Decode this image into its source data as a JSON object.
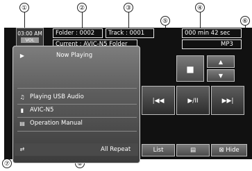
{
  "callouts": [
    "①",
    "②",
    "③",
    "④",
    "⑤",
    "⑥",
    "⑦",
    "⑧"
  ],
  "header": {
    "clock_time": "03:00",
    "clock_period": "AM",
    "clock_sub": "VOL",
    "folder": "Folder : 0002",
    "track": "Track : 0001",
    "time": "000 min  42 sec",
    "current_folder": "Current : AVIC-N5 Folder",
    "format": "MP3"
  },
  "list": {
    "items": [
      {
        "icon": "play-icon",
        "glyph": "▶",
        "label": "Now Playing"
      },
      {
        "icon": "music-file-icon",
        "glyph": "♫",
        "label": "Playing USB Audio"
      },
      {
        "icon": "folder-icon",
        "glyph": "▮",
        "label": "AVIC-N5"
      },
      {
        "icon": "document-icon",
        "glyph": "▤",
        "label": "Operation Manual"
      }
    ],
    "repeat_label": "All Repeat"
  },
  "controls": {
    "folder_glyph": "■",
    "up_glyph": "▲",
    "down_glyph": "▼",
    "prev_glyph": "|◀◀",
    "play_pause_glyph": "▶/II",
    "next_glyph": "▶▶|"
  },
  "bottom_bar": {
    "list_label": "List",
    "info_glyph": "▤",
    "hide_label": "⊠ Hide"
  }
}
